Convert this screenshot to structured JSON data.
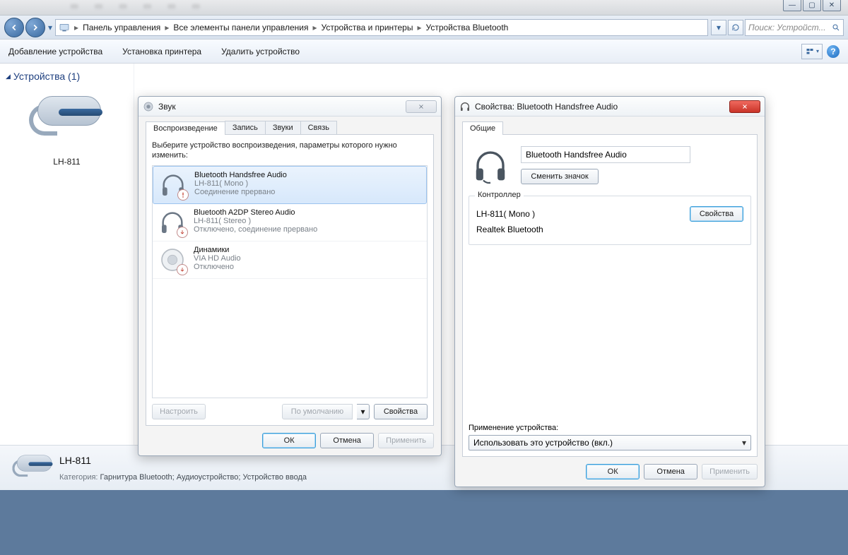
{
  "breadcrumbs": [
    "Панель управления",
    "Все элементы панели управления",
    "Устройства и принтеры",
    "Устройства Bluetooth"
  ],
  "search_placeholder": "Поиск: Устройст...",
  "commands": {
    "add": "Добавление устройства",
    "printer": "Установка принтера",
    "remove": "Удалить устройство"
  },
  "group": {
    "header": "Устройства (1)"
  },
  "device": {
    "name": "LH-811"
  },
  "sound_dialog": {
    "title": "Звук",
    "tabs": [
      "Воспроизведение",
      "Запись",
      "Звуки",
      "Связь"
    ],
    "instruction": "Выберите устройство воспроизведения, параметры которого нужно изменить:",
    "items": [
      {
        "title": "Bluetooth Handsfree Audio",
        "sub": "LH-811( Mono )",
        "status": "Соединение прервано"
      },
      {
        "title": "Bluetooth A2DP Stereo Audio",
        "sub": "LH-811( Stereo )",
        "status": "Отключено, соединение прервано"
      },
      {
        "title": "Динамики",
        "sub": "VIA HD Audio",
        "status": "Отключено"
      }
    ],
    "btn_configure": "Настроить",
    "btn_default": "По умолчанию",
    "btn_props": "Свойства",
    "btn_ok": "ОК",
    "btn_cancel": "Отмена",
    "btn_apply": "Применить"
  },
  "props_dialog": {
    "title": "Свойства: Bluetooth Handsfree Audio",
    "tab": "Общие",
    "device_name": "Bluetooth Handsfree Audio",
    "btn_change_icon": "Сменить значок",
    "controller_legend": "Контроллер",
    "controller_line1": "LH-811( Mono )",
    "controller_line2": "Realtek Bluetooth",
    "btn_ctrl_props": "Свойства",
    "usage_label": "Применение устройства:",
    "usage_value": "Использовать это устройство (вкл.)",
    "btn_ok": "ОК",
    "btn_cancel": "Отмена",
    "btn_apply": "Применить"
  },
  "details": {
    "name": "LH-811",
    "category_label": "Категория:",
    "category_value": "Гарнитура Bluetooth; Аудиоустройство; Устройство ввода"
  }
}
